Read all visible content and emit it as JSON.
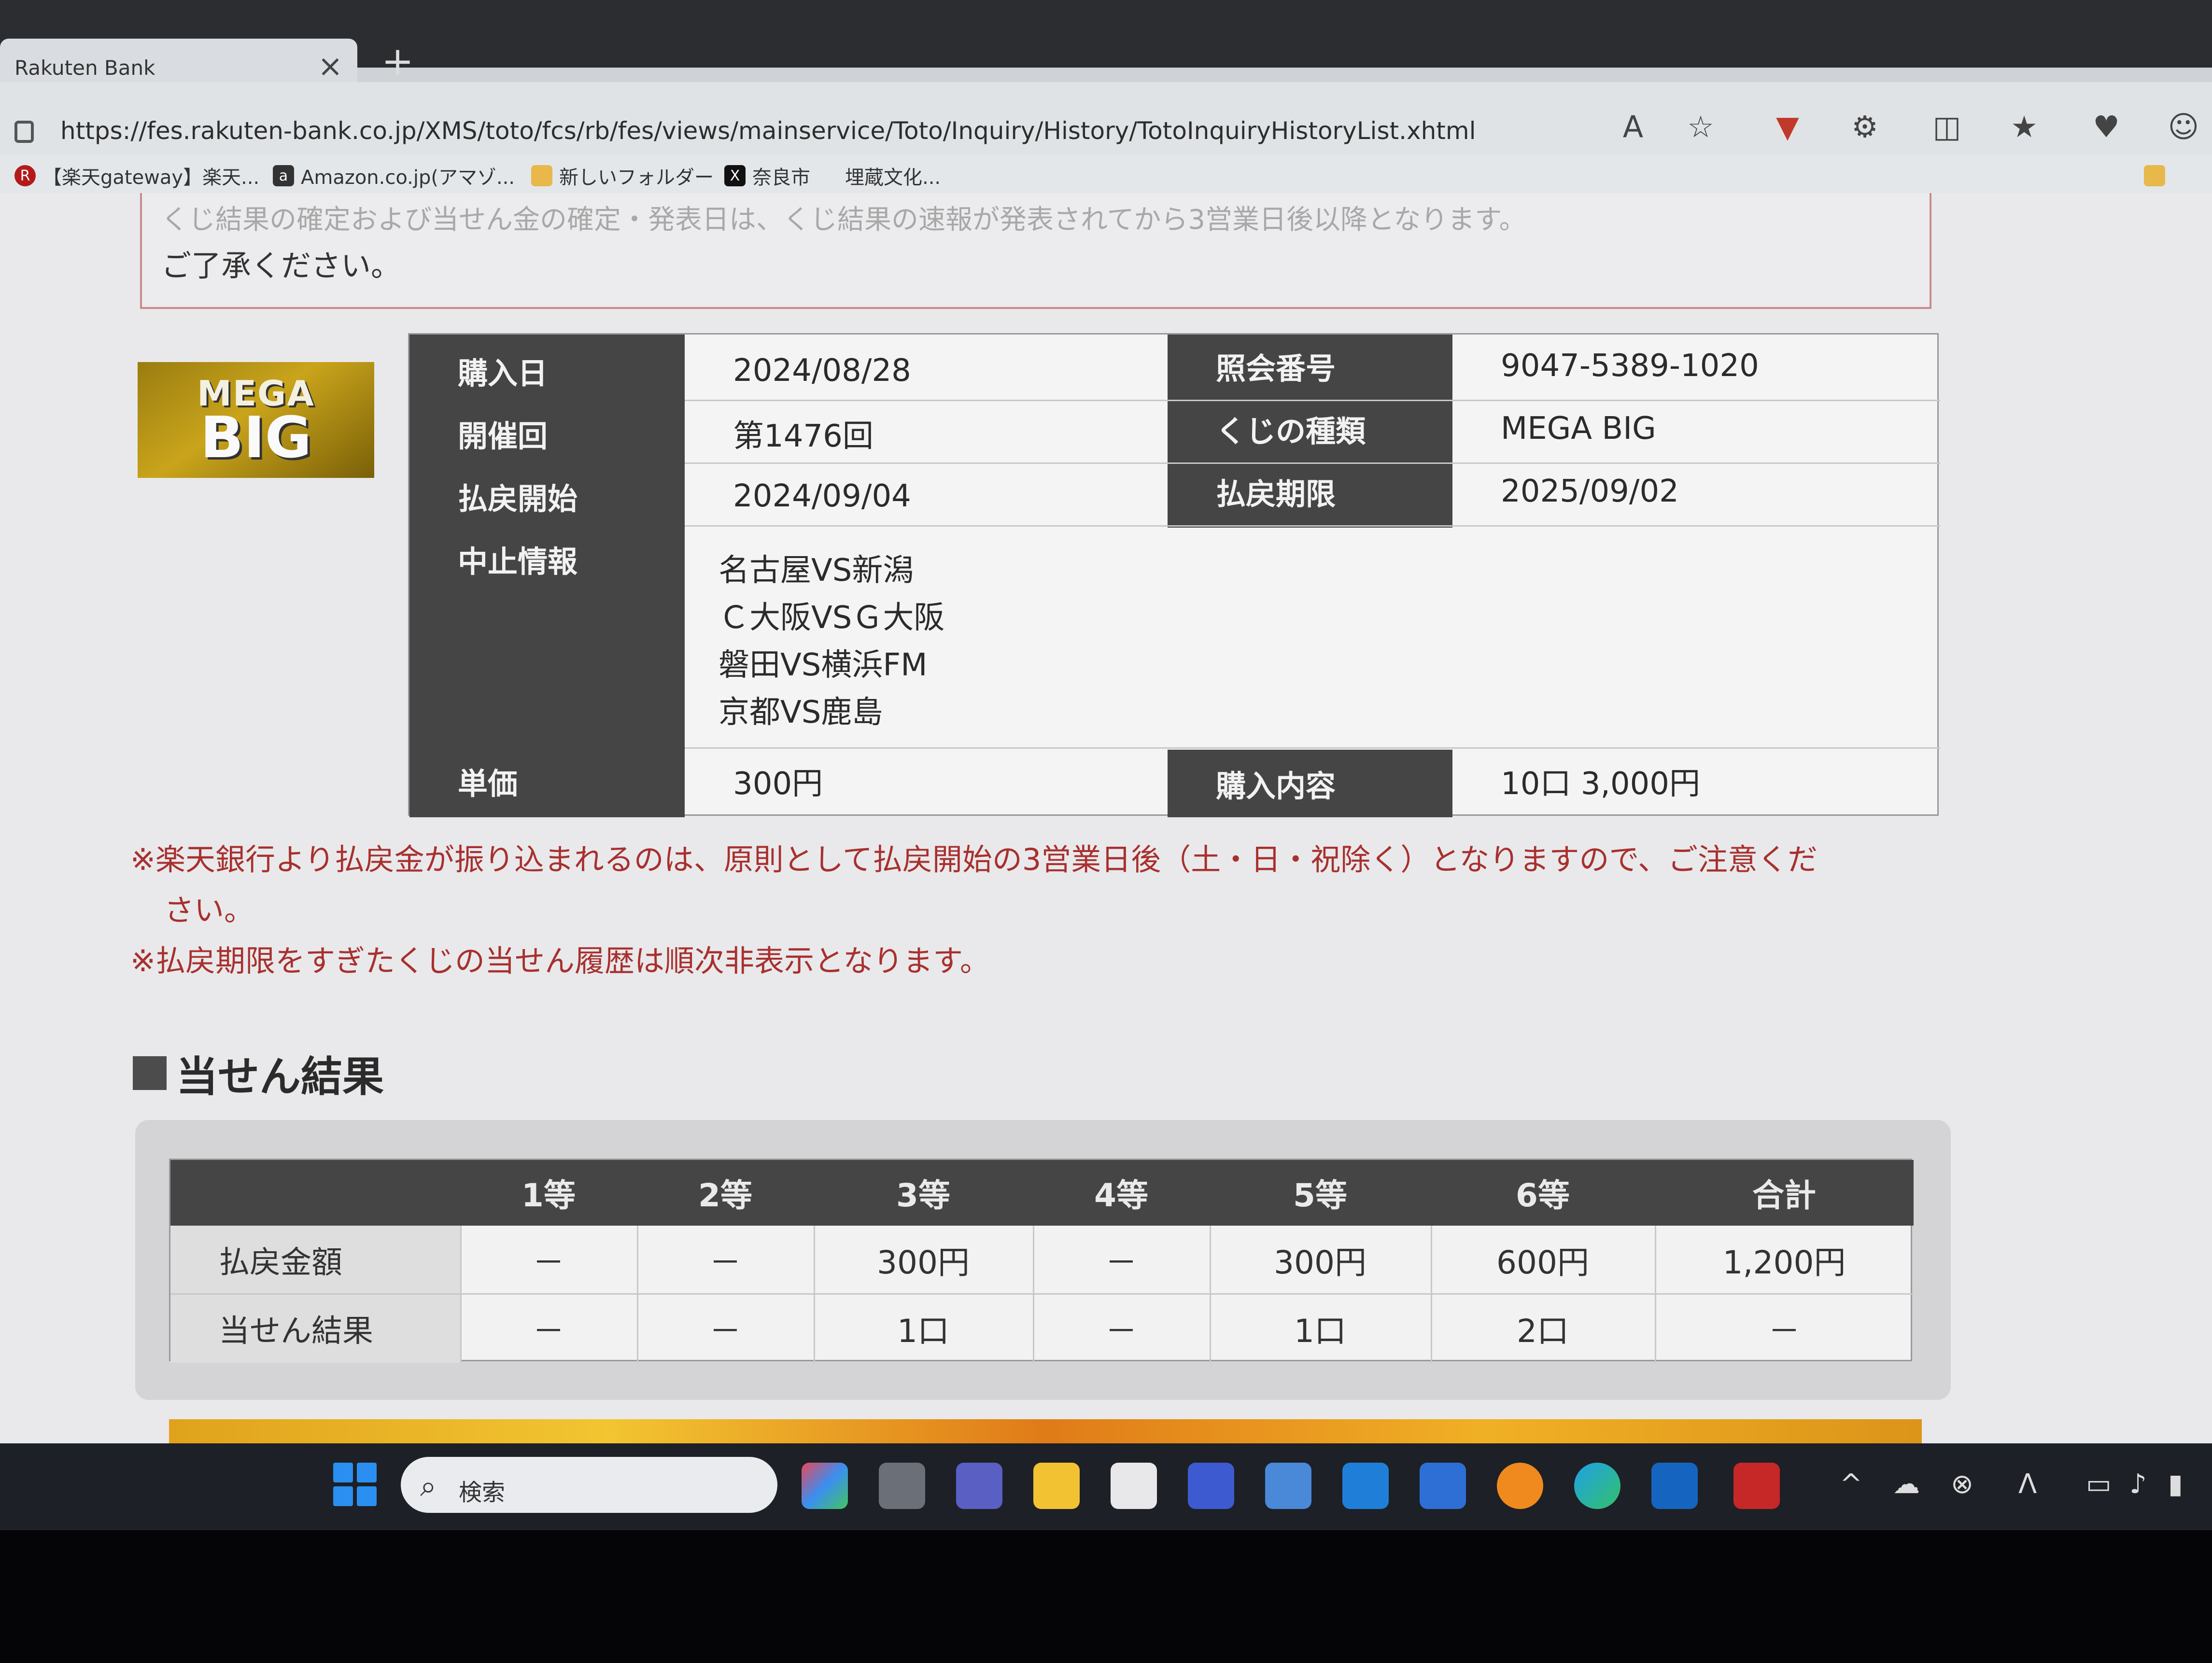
{
  "browser": {
    "tab_title": "Rakuten Bank",
    "close_glyph": "×",
    "newtab_glyph": "+",
    "url": "https://fes.rakuten-bank.co.jp/XMS/toto/fcs/rb/fes/views/mainservice/Toto/Inquiry/History/TotoInquiryHistoryList.xhtml",
    "bookmarks": [
      {
        "label": "【楽天gateway】楽天...",
        "icon": "R"
      },
      {
        "label": "Amazon.co.jp(アマゾ...",
        "icon": "a"
      },
      {
        "label": "新しいフォルダー",
        "icon": "folder"
      },
      {
        "label": "奈良市",
        "icon": "X"
      },
      {
        "label": "埋蔵文化...",
        "icon": ""
      }
    ]
  },
  "notice": {
    "partial_line": "くじ結果の確定および当せん金の確定・発表日は、くじ結果の速報が発表されてから3営業日後以降となります。",
    "last_line": "ご了承ください。"
  },
  "logo": {
    "top": "MEGA",
    "bottom": "BIG"
  },
  "info": {
    "purchase_date_label": "購入日",
    "purchase_date": "2024/08/28",
    "round_label": "開催回",
    "round": "第1476回",
    "payout_start_label": "払戻開始",
    "payout_start": "2024/09/04",
    "cancel_label": "中止情報",
    "cancel_list": [
      "名古屋VS新潟",
      "Ｃ大阪VSＧ大阪",
      "磐田VS横浜FM",
      "京都VS鹿島"
    ],
    "unit_price_label": "単価",
    "unit_price": "300円",
    "ref_no_label": "照会番号",
    "ref_no": "9047-5389-1020",
    "kind_label": "くじの種類",
    "kind": "MEGA BIG",
    "deadline_label": "払戻期限",
    "deadline": "2025/09/02",
    "content_label": "購入内容",
    "content": "10口  3,000円"
  },
  "notes": {
    "note1a": "※楽天銀行より払戻金が振り込まれるのは、原則として払戻開始の3営業日後（土・日・祝除く）となりますので、ご注意くだ",
    "note1b": "さい。",
    "note2": "※払戻期限をすぎたくじの当せん履歴は順次非表示となります。"
  },
  "results": {
    "section_title": "当せん結果",
    "headers": [
      "",
      "1等",
      "2等",
      "3等",
      "4等",
      "5等",
      "6等",
      "合計"
    ],
    "rows": [
      {
        "label": "払戻金額",
        "cells": [
          "－",
          "－",
          "300円",
          "－",
          "300円",
          "600円",
          "1,200円"
        ]
      },
      {
        "label": "当せん結果",
        "cells": [
          "－",
          "－",
          "1口",
          "－",
          "1口",
          "2口",
          "－"
        ]
      }
    ]
  },
  "taskbar": {
    "search_placeholder": "検索",
    "search_glyph": "⌕"
  },
  "colors": {
    "label_bg": "#454545",
    "note_red": "#a8302e",
    "accent_blue": "#2a8ff0"
  }
}
